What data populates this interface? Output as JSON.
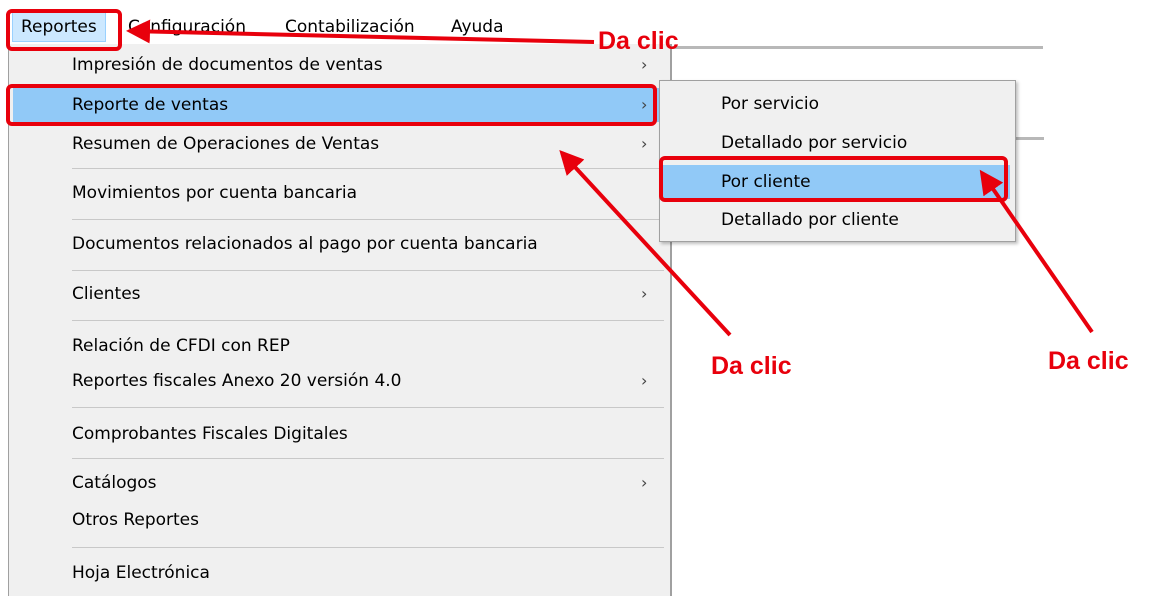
{
  "menubar": {
    "items": [
      {
        "label": "Reportes"
      },
      {
        "label": "Configuración"
      },
      {
        "label": "Contabilización"
      },
      {
        "label": "Ayuda"
      }
    ]
  },
  "menu": {
    "items": [
      {
        "label": "Impresión de documentos de ventas",
        "submenu": true
      },
      {
        "label": "Reporte de ventas",
        "submenu": true,
        "highlighted": true
      },
      {
        "label": "Resumen de Operaciones de Ventas",
        "submenu": true
      },
      {
        "label": "Movimientos por cuenta bancaria",
        "submenu": false
      },
      {
        "label": "Documentos relacionados al pago por cuenta bancaria",
        "submenu": false
      },
      {
        "label": "Clientes",
        "submenu": true
      },
      {
        "label": "Relación de CFDI con REP",
        "submenu": false
      },
      {
        "label": "Reportes fiscales Anexo 20 versión 4.0",
        "submenu": true
      },
      {
        "label": "Comprobantes Fiscales Digitales",
        "submenu": false
      },
      {
        "label": "Catálogos",
        "submenu": true
      },
      {
        "label": "Otros Reportes",
        "submenu": false
      },
      {
        "label": "Hoja Electrónica",
        "submenu": false
      }
    ],
    "chevron": "›"
  },
  "submenu": {
    "items": [
      {
        "label": "Por servicio"
      },
      {
        "label": "Detallado por servicio"
      },
      {
        "label": "Por cliente",
        "highlighted": true
      },
      {
        "label": "Detallado por cliente"
      }
    ]
  },
  "annotations": {
    "callout_1": "Da clic",
    "callout_2": "Da clic",
    "callout_3": "Da clic",
    "color": "#e8000c"
  },
  "colors": {
    "highlight": "#91c9f7",
    "menu_bg": "#f0f0f0",
    "menubar_active": "#cce8ff"
  }
}
